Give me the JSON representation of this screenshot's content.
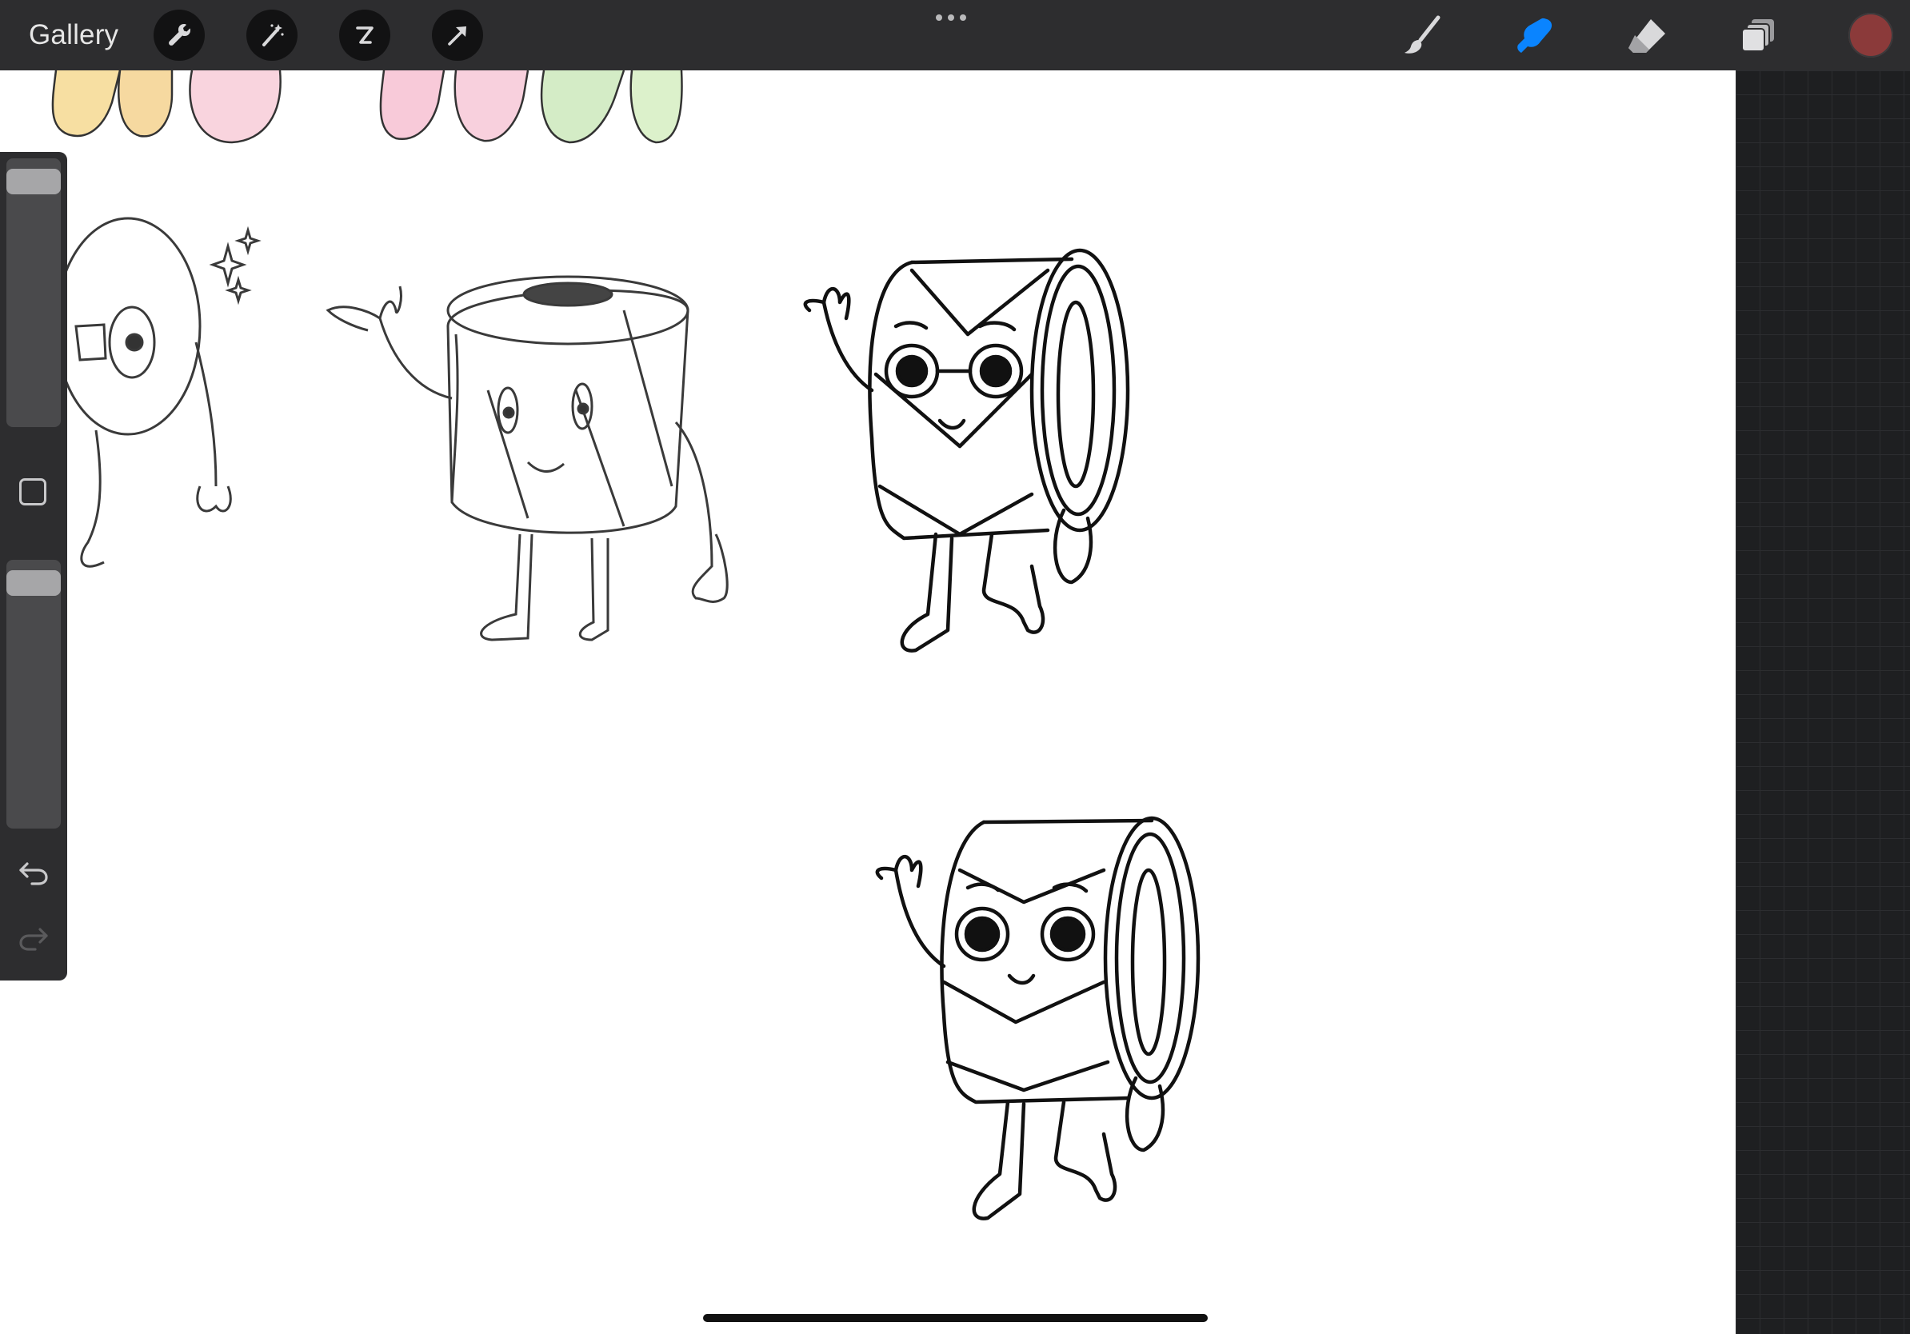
{
  "toolbar": {
    "gallery_label": "Gallery",
    "left_tools": [
      "wrench-icon",
      "magic-wand-icon",
      "selection-icon",
      "move-arrow-icon"
    ],
    "right_tools": [
      "brush-icon",
      "smudge-icon",
      "eraser-icon",
      "layers-icon"
    ],
    "active_tool": "smudge-icon",
    "current_color": "#8b3a3a",
    "active_tool_color": "#0a84ff"
  },
  "sidebar": {
    "brush_size_level": 0.03,
    "brush_opacity_level": 0.03,
    "controls": [
      "modify-square-icon",
      "undo-icon",
      "redo-icon"
    ]
  },
  "colors": {
    "toolbar_bg": "#2d2d2f",
    "canvas_bg": "#ffffff",
    "workspace_bg": "#1e1f21"
  }
}
